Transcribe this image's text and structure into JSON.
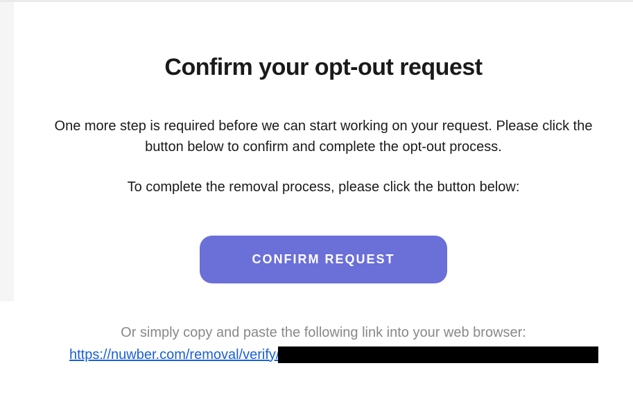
{
  "heading": "Confirm your opt-out request",
  "body_text": "One more step is required before we can start working on your request. Please click the button below to confirm and complete the opt-out process.",
  "instruction_text": "To complete the removal process, please click the button below:",
  "button_label": "CONFIRM REQUEST",
  "alt_instruction": "Or simply copy and paste the following link into your web browser:",
  "link_visible_prefix": "https://nuwber.com/removal/verify/"
}
